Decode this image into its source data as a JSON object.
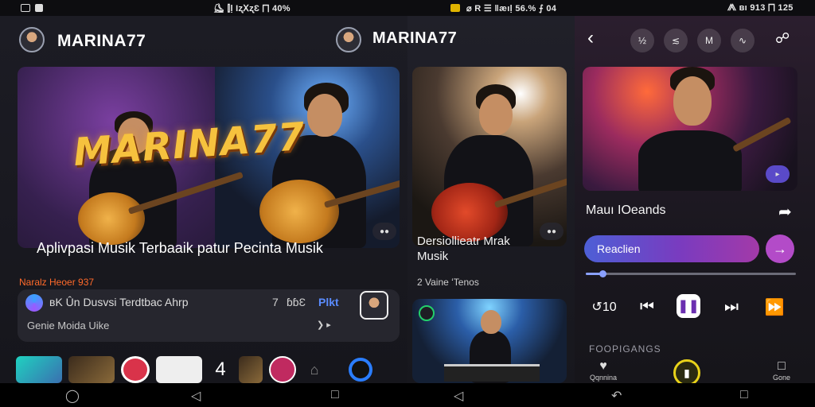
{
  "status_left": {
    "text": "⛸ ⫿ḷ ƖʐⅩʐƐ ⨅ 40%"
  },
  "status_right": {
    "left_text": "⌀ R ☰ ǁæıḷ 56.% ⨍ 04",
    "right_text": "⨇ ʙı 913 ⨅ 125"
  },
  "brand": {
    "name": "MARINA77"
  },
  "hero": {
    "logo_text": "MARINA77",
    "caption": "Aplivpasi Musik Terbaaik patur Pecinta Musik"
  },
  "promo": {
    "label": "Naralz Heoer 937"
  },
  "card": {
    "line1": "ʙK Ûn Dusvsi Terdtbac Ahrp",
    "number": "7",
    "count": "ɓɓƐ",
    "accent": "Plkt",
    "sub": "Genie Moida Uike"
  },
  "middle": {
    "title_line1": "Dersiollieatr Mrak",
    "title_line2": "Musik",
    "meta": "2 Vaine ʻTenos"
  },
  "right": {
    "song_title": "Mauı IOeands",
    "pill_label": "Reaclien",
    "section_label": "FOOPIGANGS",
    "progress": 0.08
  },
  "toolbar": {
    "icons": [
      "back-icon",
      "½",
      "≲",
      "M",
      "∿",
      "share-icon"
    ]
  },
  "tabs": {
    "tab1": "Qqnnina",
    "tab2": "Gone"
  },
  "colors": {
    "accent": "#7a3bbf",
    "brand_yellow": "#f6c23e",
    "promo_orange": "#ff6a2a"
  }
}
